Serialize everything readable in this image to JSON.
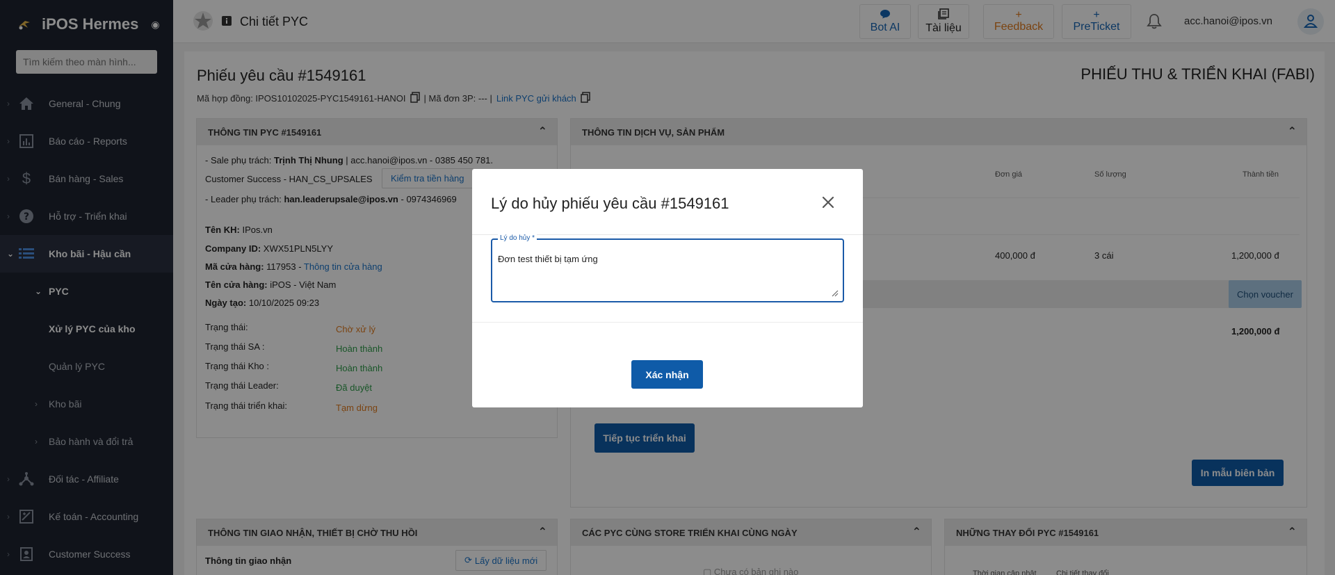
{
  "sidebar": {
    "brand": "iPOS Hermes",
    "search_placeholder": "Tìm kiếm theo màn hình...",
    "items": [
      {
        "label": "General - Chung"
      },
      {
        "label": "Báo cáo - Reports"
      },
      {
        "label": "Bán hàng - Sales"
      },
      {
        "label": "Hỗ trợ - Triển khai"
      },
      {
        "label": "Kho bãi - Hậu cần"
      },
      {
        "label": "Đối tác - Affiliate"
      },
      {
        "label": "Kế toán - Accounting"
      },
      {
        "label": "Customer Success"
      }
    ],
    "sub": {
      "pyc": "PYC",
      "xu_ly": "Xử lý PYC của kho",
      "quan_ly": "Quản lý PYC",
      "kho_bai": "Kho bãi",
      "bao_hanh": "Bảo hành và đổi trả"
    }
  },
  "topbar": {
    "title": "Chi tiết PYC",
    "buttons": {
      "bot": "Bot AI",
      "docs": "Tài liệu",
      "feedback": "Feedback",
      "preticket": "PreTicket",
      "plus": "+"
    },
    "user": "acc.hanoi@ipos.vn"
  },
  "header": {
    "title": "Phiếu yêu cầu #1549161",
    "contract": "Mã hợp đồng: IPOS10102025-PYC1549161-HANOI",
    "order3p": "| Mã đơn 3P: --- |",
    "link": "Link PYC gửi khách",
    "type": "PHIẾU THU & TRIỂN KHAI (FABI)"
  },
  "info_card": {
    "title": "THÔNG TIN PYC #1549161",
    "sale_prefix": "- Sale phụ trách:",
    "sale_name": "Trịnh Thị Nhung",
    "sale_rest": "| acc.hanoi@ipos.vn - 0385 450 781.",
    "cs": "Customer Success - HAN_CS_UPSALES",
    "check_btn": "Kiểm tra tiền hàng",
    "leader_prefix": "- Leader phụ trách:",
    "leader_email": "han.leaderupsale@ipos.vn",
    "leader_phone": "- 0974346969",
    "ten_kh_label": "Tên KH:",
    "ten_kh": "IPos.vn",
    "company_label": "Company ID:",
    "company": "XWX51PLN5LYY",
    "ma_ch_label": "Mã cửa hàng:",
    "ma_ch": "117953 -",
    "ma_ch_link": "Thông tin cửa hàng",
    "ten_ch_label": "Tên cửa hàng:",
    "ten_ch": "iPOS - Việt Nam",
    "ngay_label": "Ngày tạo:",
    "ngay": "10/10/2025 09:23",
    "statuses": [
      {
        "label": "Trạng thái:",
        "value": "Chờ xử lý"
      },
      {
        "label": "Trạng thái SA :",
        "value": "Hoàn thành"
      },
      {
        "label": "Trạng thái Kho :",
        "value": "Hoàn thành"
      },
      {
        "label": "Trạng thái Leader:",
        "value": "Đã duyệt"
      },
      {
        "label": "Trạng thái triển khai:",
        "value": "Tạm dừng"
      }
    ]
  },
  "service_card": {
    "title": "THÔNG TIN DỊCH VỤ, SẢN PHẨM",
    "headers": {
      "price": "Đơn giá",
      "qty": "Số lượng",
      "total": "Thành tiền"
    },
    "row": {
      "price": "400,000 đ",
      "qty": "3 cái",
      "total": "1,200,000 đ"
    },
    "voucher": "Chọn voucher",
    "grand_total": "1,200,000 đ",
    "continue_btn": "Tiếp tục triển khai",
    "print_btn": "In mẫu biên bản"
  },
  "bottom": {
    "delivery_title": "THÔNG TIN GIAO NHẬN, THIẾT BỊ CHỜ THU HỒI",
    "delivery_label": "Thông tin giao nhận",
    "refresh_btn": "Lấy dữ liệu mới",
    "same_store_title": "CÁC PYC CÙNG STORE TRIỂN KHAI CÙNG NGÀY",
    "empty": "Chưa có bản ghi nào",
    "changes_title": "NHỮNG THAY ĐỔI PYC #1549161",
    "col1": "Thời gian cập nhật",
    "col2": "Chi tiết thay đổi"
  },
  "modal": {
    "title": "Lý do hủy phiếu yêu cầu #1549161",
    "field_label": "Lý do hủy *",
    "field_value": "Đơn test thiết bị tạm ứng",
    "confirm": "Xác nhận"
  },
  "colors": {
    "sidebar": "#1e2430",
    "primary": "#0f5ba8",
    "link": "#1a73c8",
    "feedback": "#e07b1e",
    "success": "#2e9d4a"
  }
}
